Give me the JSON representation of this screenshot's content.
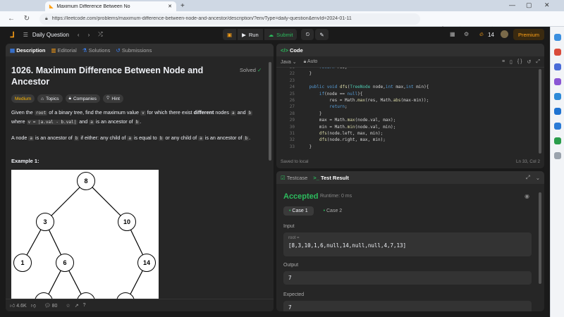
{
  "browser": {
    "tab_title": "Maximum Difference Between No",
    "url": "https://leetcode.com/problems/maximum-difference-between-node-and-ancestor/description/?envType=daily-question&envId=2024-01-11"
  },
  "nav": {
    "daily_question": "Daily Question",
    "run": "Run",
    "submit": "Submit",
    "streak": "14",
    "premium": "Premium"
  },
  "left_tabs": [
    "Description",
    "Editorial",
    "Solutions",
    "Submissions"
  ],
  "problem": {
    "title": "1026. Maximum Difference Between Node and Ancestor",
    "solved": "Solved",
    "difficulty": "Medium",
    "tags": [
      "Topics",
      "Companies",
      "Hint"
    ],
    "desc1_a": "Given the",
    "desc1_root": "root",
    "desc1_b": "of a binary tree, find the maximum value",
    "desc1_v": "v",
    "desc1_c": "for which there exist",
    "desc1_diff": "different",
    "desc1_d": "nodes",
    "desc1_a2": "a",
    "desc1_and": "and",
    "desc1_b2": "b",
    "desc2_where": "where",
    "desc2_eq": "v = |a.val - b.val|",
    "desc2_and": "and",
    "desc2_a": "a",
    "desc2_rest": "is an ancestor of",
    "desc2_b": "b",
    "desc3_a": "A node",
    "desc3_anode": "a",
    "desc3_b": "is an ancestor of",
    "desc3_bnode": "b",
    "desc3_c": "if either: any child of",
    "desc3_a2": "a",
    "desc3_d": "is equal to",
    "desc3_b2": "b",
    "desc3_e": "or any child of",
    "desc3_a3": "a",
    "desc3_f": "is an ancestor of",
    "desc3_b3": "b",
    "example_label": "Example 1:",
    "tree_nodes": [
      "8",
      "3",
      "10",
      "1",
      "6",
      "14"
    ]
  },
  "bottom_bar": {
    "likes": "4.6K",
    "comments": "80"
  },
  "code_panel": {
    "title": "Code",
    "language": "Java",
    "auto": "Auto",
    "saved": "Saved to local",
    "cursor": "Ln 33, Col 2",
    "lines": [
      {
        "n": "21",
        "t": "        return res;"
      },
      {
        "n": "22",
        "t": "    }"
      },
      {
        "n": "23",
        "t": ""
      },
      {
        "n": "24",
        "t": "    public void dfs(TreeNode node,int max,int min){"
      },
      {
        "n": "25",
        "t": "        if(node == null){"
      },
      {
        "n": "26",
        "t": "            res = Math.max(res, Math.abs(max-min));"
      },
      {
        "n": "27",
        "t": "            return;"
      },
      {
        "n": "28",
        "t": "        }"
      },
      {
        "n": "29",
        "t": "        max = Math.max(node.val, max);"
      },
      {
        "n": "30",
        "t": "        min = Math.min(node.val, min);"
      },
      {
        "n": "31",
        "t": "        dfs(node.left, max, min);"
      },
      {
        "n": "32",
        "t": "        dfs(node.right, max, min);"
      },
      {
        "n": "33",
        "t": "    }"
      }
    ]
  },
  "test_panel": {
    "tabs": [
      "Testcase",
      "Test Result"
    ],
    "status": "Accepted",
    "runtime": "Runtime: 0 ms",
    "cases": [
      "Case 1",
      "Case 2"
    ],
    "input_label": "Input",
    "param": "root =",
    "input_value": "[8,3,10,1,6,null,14,null,null,4,7,13]",
    "output_label": "Output",
    "output_value": "7",
    "expected_label": "Expected",
    "expected_value": "7"
  },
  "colors": {
    "accent": "#ffa116",
    "green": "#2cbb5d",
    "bg": "#1a1a1a",
    "panel": "#262626"
  }
}
